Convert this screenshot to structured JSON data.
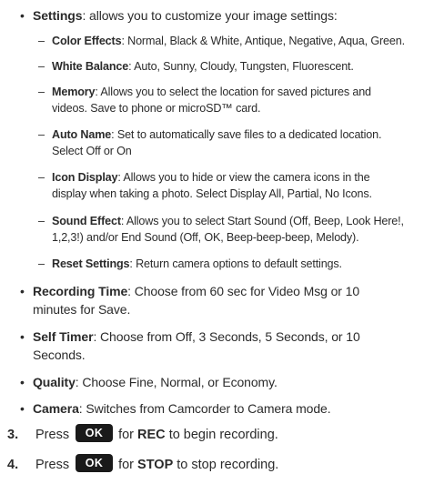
{
  "settings": {
    "term": "Settings",
    "desc": ": allows you to customize your image settings:",
    "subitems": [
      {
        "term": "Color Effects",
        "desc": ": Normal, Black & White, Antique, Negative, Aqua, Green."
      },
      {
        "term": "White Balance",
        "desc": ": Auto, Sunny, Cloudy, Tungsten, Fluorescent."
      },
      {
        "term": "Memory",
        "desc": ": Allows you to select the location for saved pictures and",
        "desc2": "videos. Save to phone or microSD™ card."
      },
      {
        "term": "Auto Name",
        "desc": ": Set to automatically save files to a dedicated location.",
        "desc2": "Select Off or On"
      },
      {
        "term": "Icon Display",
        "desc": ": Allows you to hide or view the camera icons in the",
        "desc2": "display when taking a photo. Select Display All, Partial, No Icons."
      },
      {
        "term": "Sound Effect",
        "desc": ": Allows you to select Start Sound (Off, Beep, Look Here!,",
        "desc2": "1,2,3!) and/or End Sound (Off, OK, Beep-beep-beep, Melody)."
      },
      {
        "term": "Reset Settings",
        "desc": ": Return camera options to default settings."
      }
    ]
  },
  "bullets": [
    {
      "term": "Recording Time",
      "desc": ": Choose from 60 sec for Video Msg or 10",
      "desc2": "minutes for Save."
    },
    {
      "term": "Self Timer",
      "desc": ": Choose from Off, 3 Seconds, 5 Seconds, or 10",
      "desc2": "Seconds."
    },
    {
      "term": "Quality",
      "desc": ": Choose Fine, Normal, or Economy."
    },
    {
      "term": "Camera",
      "desc": ": Switches from Camcorder to Camera mode."
    }
  ],
  "steps": [
    {
      "num": "3.",
      "pre": "Press",
      "key": "OK",
      "mid": "for",
      "bold": "REC",
      "post": "to begin recording."
    },
    {
      "num": "4.",
      "pre": "Press",
      "key": "OK",
      "mid": "for",
      "bold": "STOP",
      "post": "to stop recording."
    }
  ]
}
